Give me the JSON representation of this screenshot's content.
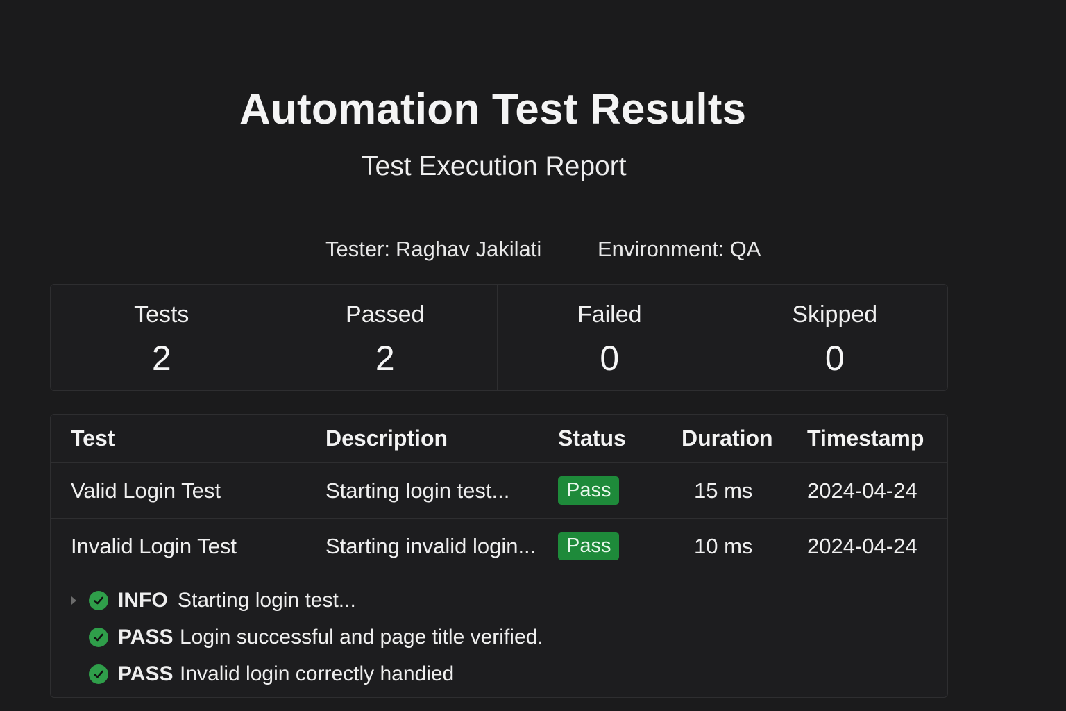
{
  "header": {
    "title": "Automation Test Results",
    "subtitle": "Test Execution Report"
  },
  "meta": {
    "tester_label": "Tester:",
    "tester_value": "Raghav Jakilati",
    "environment_label": "Environment:",
    "environment_value": "QA"
  },
  "stats": [
    {
      "label": "Tests",
      "value": "2"
    },
    {
      "label": "Passed",
      "value": "2"
    },
    {
      "label": "Failed",
      "value": "0"
    },
    {
      "label": "Skipped",
      "value": "0"
    }
  ],
  "table": {
    "columns": [
      "Test",
      "Description",
      "Status",
      "Duration",
      "Timestamp"
    ],
    "rows": [
      {
        "test": "Valid Login Test",
        "description": "Starting login test...",
        "status": "Pass",
        "duration": "15 ms",
        "timestamp": "2024-04-24"
      },
      {
        "test": "Invalid Login Test",
        "description": "Starting invalid login...",
        "status": "Pass",
        "duration": "10 ms",
        "timestamp": "2024-04-24"
      }
    ]
  },
  "log": [
    {
      "level": "INFO",
      "message": "Starting login test...",
      "icon": "check-circle-icon"
    },
    {
      "level": "PASS",
      "message": "Login successful and page title verified.",
      "icon": "check-circle-icon"
    },
    {
      "level": "PASS",
      "message": "Invalid login correctly handied",
      "icon": "check-circle-icon"
    }
  ],
  "colors": {
    "background": "#1b1b1c",
    "pass_badge": "#1e8a3a",
    "check_icon": "#2f9e4a"
  }
}
